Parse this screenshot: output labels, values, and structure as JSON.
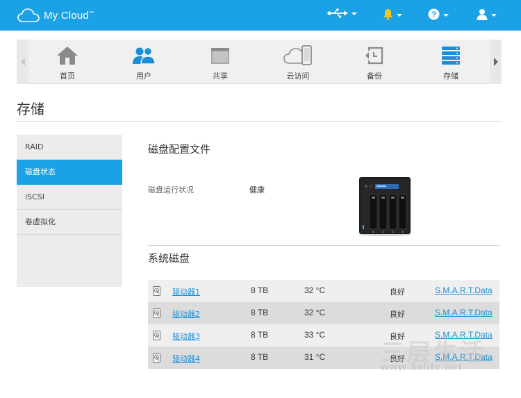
{
  "app": {
    "name": "My Cloud",
    "trademark": "™"
  },
  "topbar": {
    "icons": [
      "usb-icon",
      "bell-icon",
      "help-icon",
      "user-icon"
    ],
    "bell_color": "#f5c518",
    "accent": "#1aa1e6"
  },
  "nav": {
    "items": [
      {
        "label": "首页",
        "icon": "home-icon"
      },
      {
        "label": "用户",
        "icon": "users-icon"
      },
      {
        "label": "共享",
        "icon": "folder-icon"
      },
      {
        "label": "云访问",
        "icon": "cloud-access-icon"
      },
      {
        "label": "备份",
        "icon": "backup-icon"
      },
      {
        "label": "存储",
        "icon": "storage-icon"
      }
    ],
    "active": "存储"
  },
  "page": {
    "title": "存储"
  },
  "sidebar": {
    "items": [
      {
        "label": "RAID"
      },
      {
        "label": "磁盘状态"
      },
      {
        "label": "iSCSI"
      },
      {
        "label": "卷虚拟化"
      }
    ],
    "active": "磁盘状态"
  },
  "main": {
    "profile_title": "磁盘配置文件",
    "health_label": "磁盘运行状况",
    "health_value": "健康",
    "system_disks_title": "系统磁盘",
    "drives": [
      {
        "name": "驱动器1",
        "capacity": "8 TB",
        "temp": "32 °C",
        "status": "良好",
        "smart": "S.M.A.R.T.Data"
      },
      {
        "name": "驱动器2",
        "capacity": "8 TB",
        "temp": "32 °C",
        "status": "良好",
        "smart": "S.M.A.R.T.Data"
      },
      {
        "name": "驱动器3",
        "capacity": "8 TB",
        "temp": "33 °C",
        "status": "良好",
        "smart": "S.M.A.R.T.Data"
      },
      {
        "name": "驱动器4",
        "capacity": "8 TB",
        "temp": "31 °C",
        "status": "良好",
        "smart": "S.M.A.R.T.Data"
      }
    ]
  },
  "watermark": {
    "big": "三层生活",
    "url": "www.3elife.net"
  }
}
